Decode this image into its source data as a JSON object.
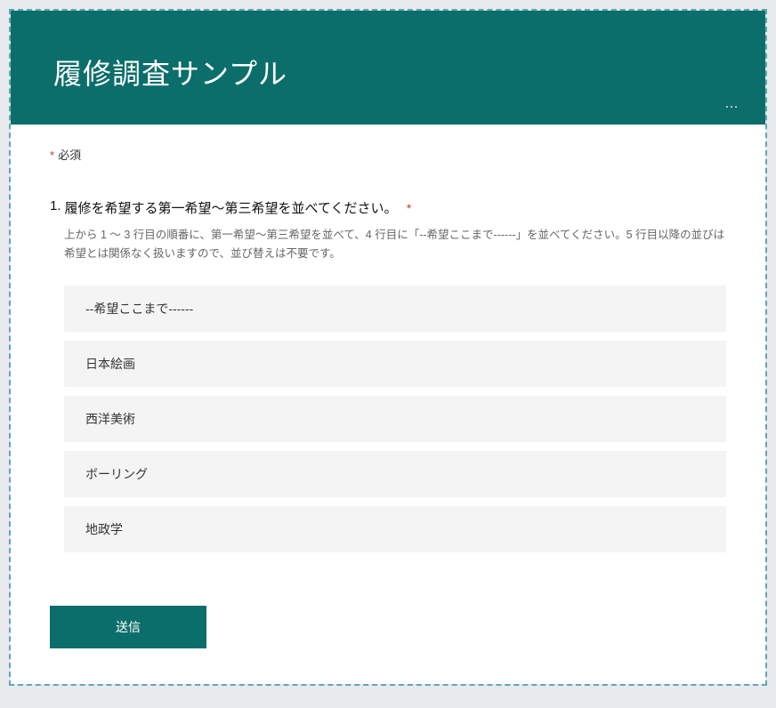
{
  "colors": {
    "accent": "#0b6e6a",
    "asterisk": "#c43e1c",
    "optionBg": "#f4f4f4"
  },
  "header": {
    "title": "履修調査サンプル",
    "menu_icon_label": "…"
  },
  "required_note": {
    "asterisk": "*",
    "text": "必須"
  },
  "question": {
    "number": "1.",
    "title": "履修を希望する第一希望～第三希望を並べてください。",
    "required_asterisk": "*",
    "description": "上から 1 ～ 3 行目の順番に、第一希望～第三希望を並べて、4 行目に「--希望ここまで------」を並べてください。5 行目以降の並びは希望とは関係なく扱いますので、並び替えは不要です。",
    "options": [
      "--希望ここまで------",
      "日本絵画",
      "西洋美術",
      "ボーリング",
      "地政学"
    ]
  },
  "submit_label": "送信"
}
